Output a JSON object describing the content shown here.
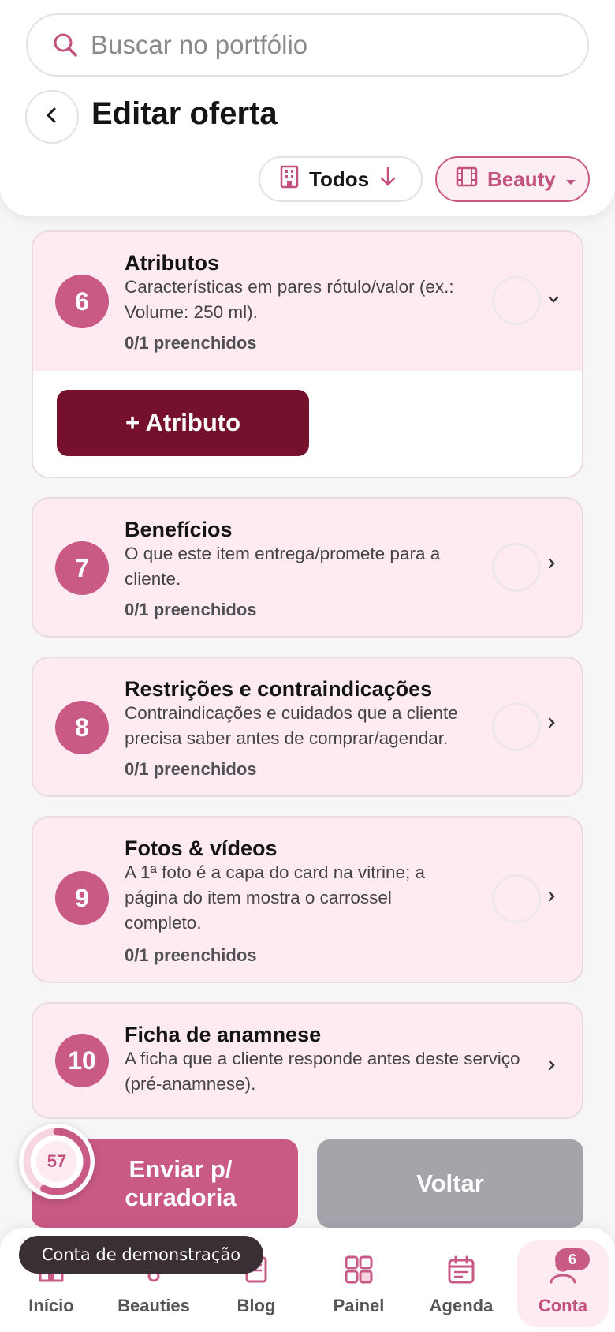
{
  "search": {
    "placeholder": "Buscar no portfólio"
  },
  "header": {
    "title": "Editar oferta"
  },
  "filters": {
    "todos_label": "Todos",
    "beauty_label": "Beauty"
  },
  "sections": [
    {
      "number": "6",
      "title": "Atributos",
      "description": "Características em pares rótulo/valor (ex.: Volume: 250 ml).",
      "count": "0/1 preenchidos",
      "expanded": true,
      "add_button": "+ Atributo"
    },
    {
      "number": "7",
      "title": "Benefícios",
      "description": "O que este item entrega/promete para a cliente.",
      "count": "0/1 preenchidos"
    },
    {
      "number": "8",
      "title": "Restrições e contraindicações",
      "description": "Contraindicações e cuidados que a cliente precisa saber antes de comprar/agendar.",
      "count": "0/1 preenchidos"
    },
    {
      "number": "9",
      "title": "Fotos & vídeos",
      "description": "A 1ª foto é a capa do card na vitrine; a página do item mostra o carrossel completo.",
      "count": "0/1 preenchidos"
    },
    {
      "number": "10",
      "title": "Ficha de anamnese",
      "description": "A ficha que a cliente responde antes deste serviço (pré-anamnese)."
    }
  ],
  "actions": {
    "send_line1": "Enviar p/",
    "send_line2": "curadoria",
    "back": "Voltar",
    "progress": "57"
  },
  "nav": [
    {
      "label": "Início",
      "icon": "home-icon"
    },
    {
      "label": "Beauties",
      "icon": "beauties-icon"
    },
    {
      "label": "Blog",
      "icon": "blog-icon"
    },
    {
      "label": "Painel",
      "icon": "grid-icon"
    },
    {
      "label": "Agenda",
      "icon": "calendar-icon"
    },
    {
      "label": "Conta",
      "icon": "user-icon",
      "badge": "6",
      "active": true
    }
  ],
  "toast": "Conta de demonstração",
  "colors": {
    "accent": "#c95a85",
    "dark_accent": "#75112d",
    "card_bg": "#fdebf1",
    "muted_button": "#a5a4ab"
  }
}
